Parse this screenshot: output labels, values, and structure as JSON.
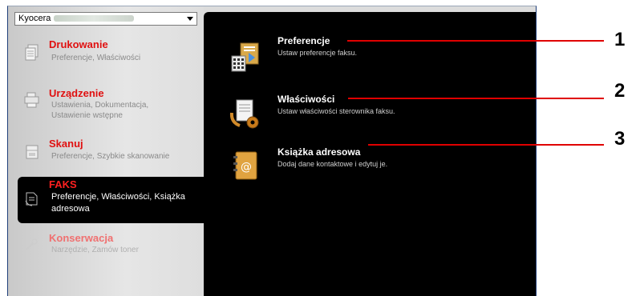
{
  "device_select": {
    "value": "Kyocera"
  },
  "menu": [
    {
      "title": "Drukowanie",
      "subtitle_lines": [
        "Preferencje, Właściwości"
      ],
      "icon": "printer-pages-icon"
    },
    {
      "title": "Urządzenie",
      "subtitle_lines": [
        "Ustawienia, Dokumentacja,",
        "Ustawienie wstępne"
      ],
      "icon": "device-icon"
    },
    {
      "title": "Skanuj",
      "subtitle_lines": [
        "Preferencje, Szybkie skanowanie"
      ],
      "icon": "scanner-icon"
    },
    {
      "title": "FAKS",
      "subtitle_lines": [
        "Preferencje, Właściwości, Książka",
        "adresowa"
      ],
      "icon": "fax-icon",
      "active": true
    },
    {
      "title": "Konserwacja",
      "subtitle_lines": [
        "Narzędzie, Zamów toner"
      ],
      "icon": "maintenance-icon"
    }
  ],
  "options": [
    {
      "title": "Preferencje",
      "description": "Ustaw preferencje faksu.",
      "icon": "fax-preferences-icon"
    },
    {
      "title": "Właściwości",
      "description": "Ustaw właściwości sterownika faksu.",
      "icon": "fax-properties-icon"
    },
    {
      "title": "Książka adresowa",
      "description": "Dodaj dane kontaktowe i edytuj je.",
      "icon": "address-book-icon"
    }
  ],
  "callouts": [
    "1",
    "2",
    "3"
  ],
  "colors": {
    "accent_red": "#e01010",
    "callout_red": "#e00000",
    "content_bg": "#000000"
  }
}
